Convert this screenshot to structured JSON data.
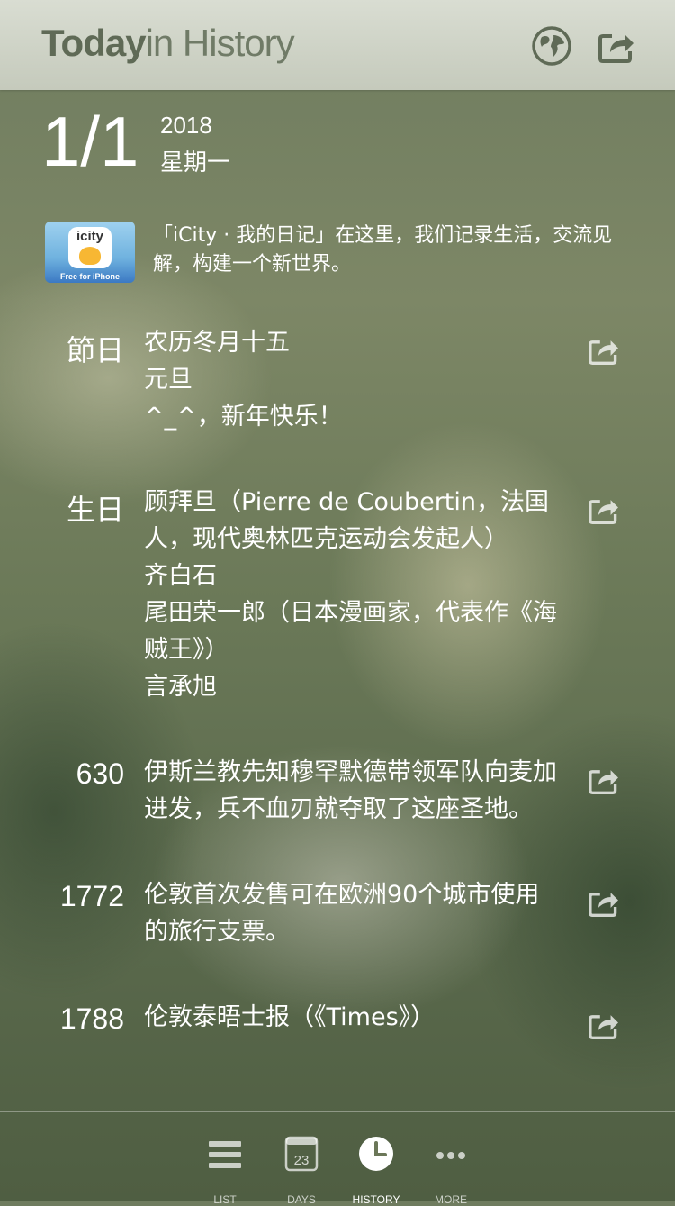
{
  "app": {
    "logo_bold": "Today",
    "logo_light": "in History"
  },
  "header": {
    "date": "1/1",
    "year": "2018",
    "weekday": "星期一"
  },
  "ad": {
    "icon_brand": "icity",
    "icon_caption": "Free for iPhone",
    "text": "「iCity · 我的日记」在这里，我们记录生活，交流见解，构建一个新世界。"
  },
  "entries": [
    {
      "label": "節日",
      "lines": [
        "农历冬月十五",
        "元旦",
        "^_^，新年快乐！"
      ]
    },
    {
      "label": "生日",
      "lines": [
        "顾拜旦（Pierre de Coubertin，法国人，现代奥林匹克运动会发起人）",
        "齐白石",
        "尾田荣一郎（日本漫画家，代表作《海贼王》）",
        "言承旭"
      ]
    },
    {
      "label": "630",
      "lines": [
        "伊斯兰教先知穆罕默德带领军队向麦加进发，兵不血刃就夺取了这座圣地。"
      ]
    },
    {
      "label": "1772",
      "lines": [
        "伦敦首次发售可在欧洲90个城市使用的旅行支票。"
      ]
    },
    {
      "label": "1788",
      "lines": [
        "伦敦泰晤士报（《Times》）"
      ]
    }
  ],
  "tabs": [
    {
      "label": "LIST",
      "icon": "list-icon"
    },
    {
      "label": "DAYS",
      "icon": "calendar-icon",
      "badge": "23"
    },
    {
      "label": "HISTORY",
      "icon": "clock-icon",
      "active": true
    },
    {
      "label": "MORE",
      "icon": "more-icon"
    }
  ]
}
